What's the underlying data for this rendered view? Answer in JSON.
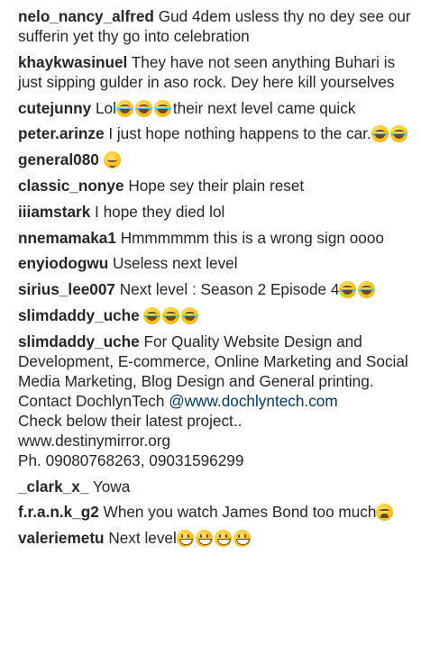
{
  "comments": [
    {
      "user": "nelo_nancy_alfred",
      "text": "Gud 4dem usless thy no dey see our sufferin yet thy go into celebration"
    },
    {
      "user": "khaykwasinuel",
      "text": "They have not seen anything Buhari is just sipping gulder in aso rock. Dey here kill yourselves"
    },
    {
      "user": "cutejunny",
      "text": "Lol",
      "emoji": [
        "joy",
        "joy",
        "joy"
      ],
      "text_after": "their next level came quick"
    },
    {
      "user": "peter.arinze",
      "text": "I just hope nothing happens to the car.",
      "emoji": [
        "joy",
        "joy"
      ]
    },
    {
      "user": "general080",
      "text": "",
      "emoji": [
        "relieved"
      ]
    },
    {
      "user": "classic_nonye",
      "text": "Hope sey their plain reset"
    },
    {
      "user": "iiiamstark",
      "text": "I hope they died lol"
    },
    {
      "user": "nnemamaka1",
      "text": "Hmmmmmm this is a wrong sign oooo"
    },
    {
      "user": "enyiodogwu",
      "text": "Useless next level"
    },
    {
      "user": "sirius_lee007",
      "text": "Next level : Season 2 Episode 4",
      "emoji": [
        "joy",
        "joy"
      ]
    },
    {
      "user": "slimdaddy_uche",
      "text": "",
      "emoji": [
        "joy",
        "joy",
        "joy"
      ]
    },
    {
      "user": "slimdaddy_uche",
      "text": "For Quality Website Design and Development, E-commerce, Online Marketing and Social Media Marketing, Blog Design and General printing.\nContact DochlynTech ",
      "link": "@www.dochlyntech.com",
      "text_after": "\nCheck below their latest project..\nwww.destinymirror.org\nPh. 09080768263, 09031596299"
    },
    {
      "user": "_clark_x_",
      "text": "Yowa"
    },
    {
      "user": "f.r.a.n.k_g2",
      "text": "When you watch James Bond too much",
      "emoji": [
        "tired"
      ]
    },
    {
      "user": "valeriemetu",
      "text": "Next level",
      "emoji": [
        "grin",
        "grin",
        "grin",
        "grin"
      ]
    }
  ],
  "colors": {
    "username": "#262626",
    "text": "#262626",
    "mention_link": "#003569",
    "background": "#ffffff"
  }
}
